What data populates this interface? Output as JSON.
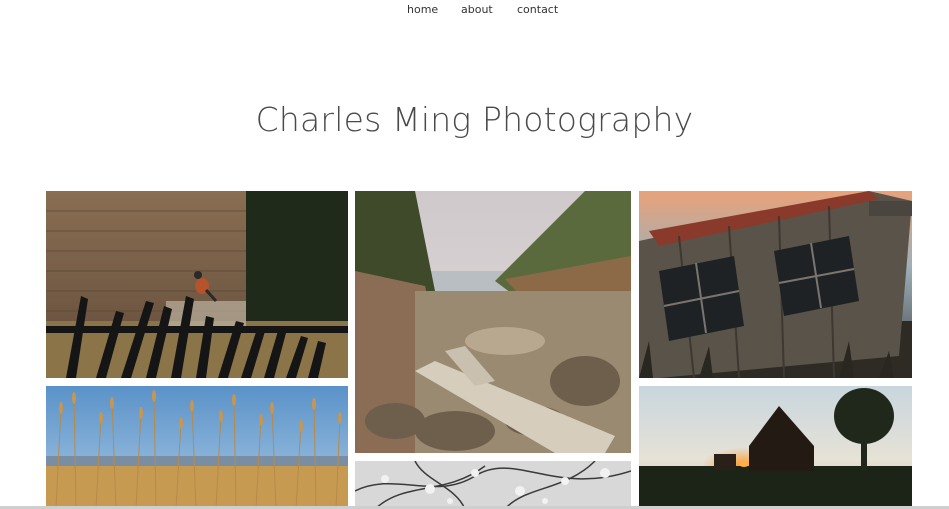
{
  "nav": {
    "items": [
      {
        "label": "home"
      },
      {
        "label": "about"
      },
      {
        "label": "contact"
      }
    ]
  },
  "site": {
    "title": "Charles Ming Photography"
  },
  "gallery": {
    "photos": [
      {
        "subject": "robin on weathered fence before wooden barn"
      },
      {
        "subject": "coastal cove with driftwood and rocks"
      },
      {
        "subject": "abandoned tilted wooden shack at sunset"
      },
      {
        "subject": "golden grass seed heads against blue sky"
      },
      {
        "subject": "flowering tree branches"
      },
      {
        "subject": "barn silhouette at sunset"
      }
    ]
  }
}
